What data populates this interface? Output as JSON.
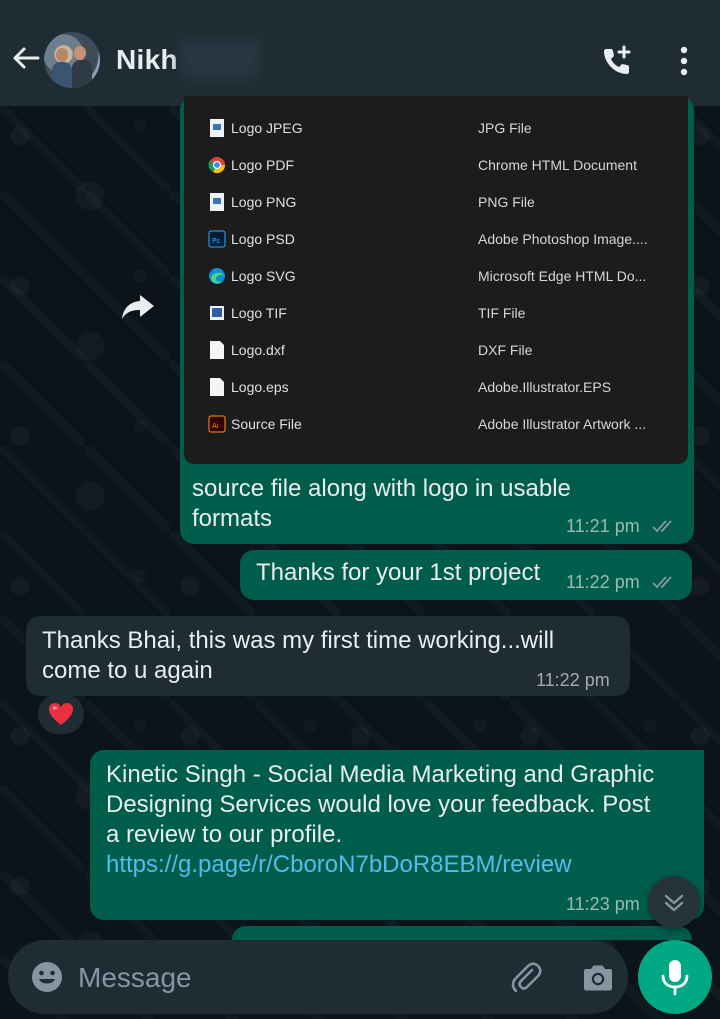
{
  "header": {
    "contact_name": "Nikh",
    "icons": {
      "back": "arrow-left-icon",
      "call": "add-call-icon",
      "menu": "more-vert-icon"
    }
  },
  "file_list_image": {
    "files": [
      {
        "name": "Logo JPEG",
        "type": "JPG File",
        "icon": "image-file-icon"
      },
      {
        "name": "Logo PDF",
        "type": "Chrome HTML Document",
        "icon": "chrome-icon"
      },
      {
        "name": "Logo PNG",
        "type": "PNG File",
        "icon": "image-file-icon"
      },
      {
        "name": "Logo PSD",
        "type": "Adobe Photoshop Image....",
        "icon": "photoshop-icon"
      },
      {
        "name": "Logo SVG",
        "type": "Microsoft Edge HTML Do...",
        "icon": "edge-icon"
      },
      {
        "name": "Logo TIF",
        "type": "TIF File",
        "icon": "image-file-icon"
      },
      {
        "name": "Logo.dxf",
        "type": "DXF File",
        "icon": "blank-file-icon"
      },
      {
        "name": "Logo.eps",
        "type": "Adobe.Illustrator.EPS",
        "icon": "blank-file-icon"
      },
      {
        "name": "Source File",
        "type": "Adobe Illustrator Artwork ...",
        "icon": "illustrator-icon"
      }
    ]
  },
  "messages": [
    {
      "direction": "out",
      "text_line1": "source file along with logo in usable",
      "text_line2": "formats",
      "time": "11:21 pm",
      "status": "read"
    },
    {
      "direction": "out",
      "text": "Thanks for your 1st project",
      "time": "11:22 pm",
      "status": "read"
    },
    {
      "direction": "in",
      "text_line1": "Thanks Bhai, this was my first time working...will",
      "text_line2": "come to u again",
      "time": "11:22 pm",
      "reaction": "❤️"
    },
    {
      "direction": "out",
      "text_line1": "Kinetic Singh - Social Media Marketing and Graphic",
      "text_line2": "Designing Services would love your feedback. Post",
      "text_line3": "a review to our profile.",
      "link": "https://g.page/r/CboroN7bDoR8EBM/review",
      "time": "11:23 pm"
    }
  ],
  "input": {
    "placeholder": "Message"
  },
  "colors": {
    "header": "#1f2c34",
    "outgoing": "#005c4b",
    "incoming": "#202c33",
    "accent": "#00a884",
    "link": "#53bdeb",
    "read_ticks": "#8696a0"
  }
}
